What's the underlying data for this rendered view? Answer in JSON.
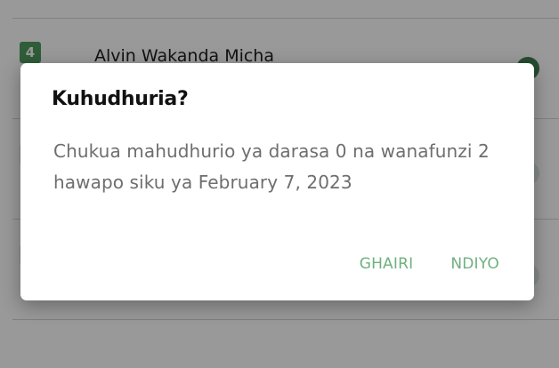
{
  "background_list": {
    "rows": [
      {
        "number": "4",
        "name": "Alvin Wakanda Micha"
      }
    ]
  },
  "dialog": {
    "title": "Kuhudhuria?",
    "message": "Chukua mahudhurio ya darasa 0 na wanafunzi 2 hawapo siku ya February 7, 2023",
    "cancel_label": "GHAIRI",
    "confirm_label": "NDIYO"
  },
  "colors": {
    "accent": "#6fb07f",
    "badge": "#4f9a5f",
    "scrim": "rgba(0,0,0,0.40)"
  }
}
